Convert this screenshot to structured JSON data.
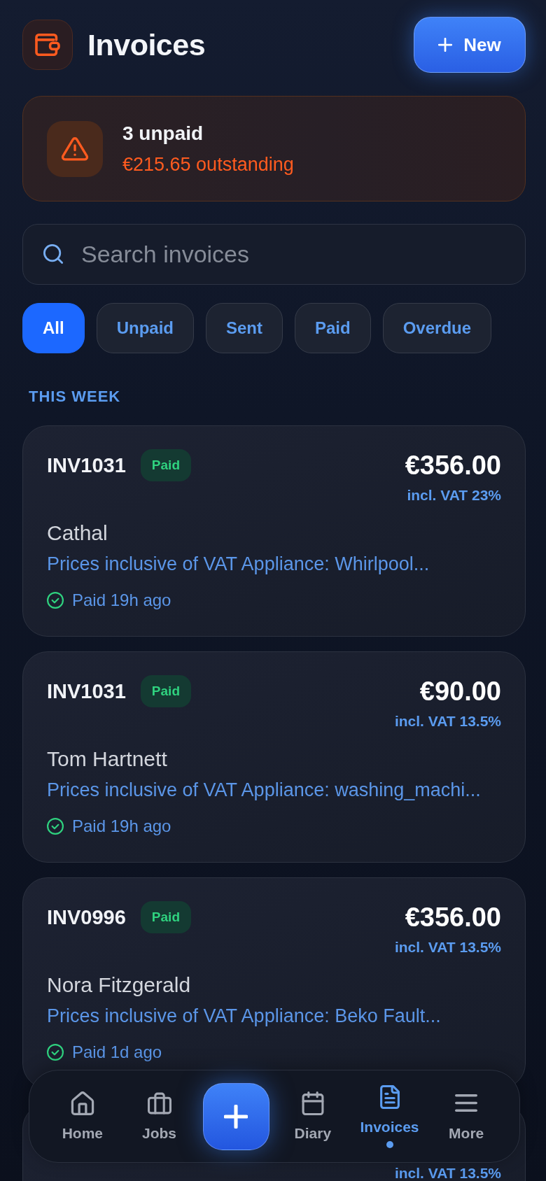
{
  "header": {
    "title": "Invoices",
    "new_button": "New"
  },
  "alert": {
    "title": "3 unpaid",
    "detail": "€215.65 outstanding"
  },
  "search": {
    "placeholder": "Search invoices"
  },
  "filters": [
    {
      "label": "All",
      "selected": true
    },
    {
      "label": "Unpaid",
      "selected": false
    },
    {
      "label": "Sent",
      "selected": false
    },
    {
      "label": "Paid",
      "selected": false
    },
    {
      "label": "Overdue",
      "selected": false
    }
  ],
  "sections": [
    {
      "title": "THIS WEEK",
      "invoices": [
        {
          "number": "INV1031",
          "status": {
            "label": "Paid",
            "kind": "paid"
          },
          "amount": "€356.00",
          "vat": "incl. VAT 23%",
          "customer": "Cathal",
          "description": "Prices inclusive of VAT Appliance: Whirlpool...",
          "payment_note": "Paid 19h ago"
        },
        {
          "number": "INV1031",
          "status": {
            "label": "Paid",
            "kind": "paid"
          },
          "amount": "€90.00",
          "vat": "incl. VAT 13.5%",
          "customer": "Tom Hartnett",
          "description": "Prices inclusive of VAT Appliance: washing_machi...",
          "payment_note": "Paid 19h ago"
        },
        {
          "number": "INV0996",
          "status": {
            "label": "Paid",
            "kind": "paid"
          },
          "amount": "€356.00",
          "vat": "incl. VAT 13.5%",
          "customer": "Nora Fitzgerald",
          "description": "Prices inclusive of VAT Appliance: Beko Fault...",
          "payment_note": "Paid 1d ago"
        },
        {
          "vat": "incl. VAT 13.5%"
        }
      ]
    }
  ],
  "bottom_nav": {
    "tabs_left": [
      {
        "label": "Home",
        "selected": false
      },
      {
        "label": "Jobs",
        "selected": false
      }
    ],
    "tabs_right": [
      {
        "label": "Diary",
        "selected": false
      },
      {
        "label": "Invoices",
        "selected": true
      },
      {
        "label": "More",
        "selected": false
      }
    ]
  }
}
